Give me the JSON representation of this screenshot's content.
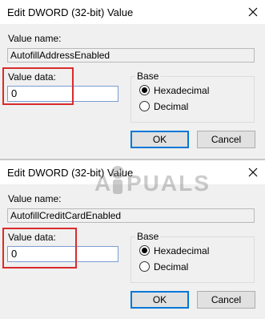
{
  "dialogs": [
    {
      "title": "Edit DWORD (32-bit) Value",
      "value_name_label": "Value name:",
      "value_name": "AutofillAddressEnabled",
      "value_data_label": "Value data:",
      "value_data": "0",
      "base_label": "Base",
      "radio_hex": "Hexadecimal",
      "radio_dec": "Decimal",
      "selected_base": "Hexadecimal",
      "ok": "OK",
      "cancel": "Cancel"
    },
    {
      "title": "Edit DWORD (32-bit) Value",
      "value_name_label": "Value name:",
      "value_name": "AutofillCreditCardEnabled",
      "value_data_label": "Value data:",
      "value_data": "0",
      "base_label": "Base",
      "radio_hex": "Hexadecimal",
      "radio_dec": "Decimal",
      "selected_base": "Hexadecimal",
      "ok": "OK",
      "cancel": "Cancel"
    }
  ],
  "watermark": {
    "text_left": "A",
    "text_right": "PUALS"
  },
  "colors": {
    "highlight": "#d92b2b",
    "focus_border": "#0078d7",
    "dialog_bg": "#f0f0f0"
  },
  "icons": {
    "close": "close-icon",
    "watermark_mascot": "mascot-icon"
  }
}
